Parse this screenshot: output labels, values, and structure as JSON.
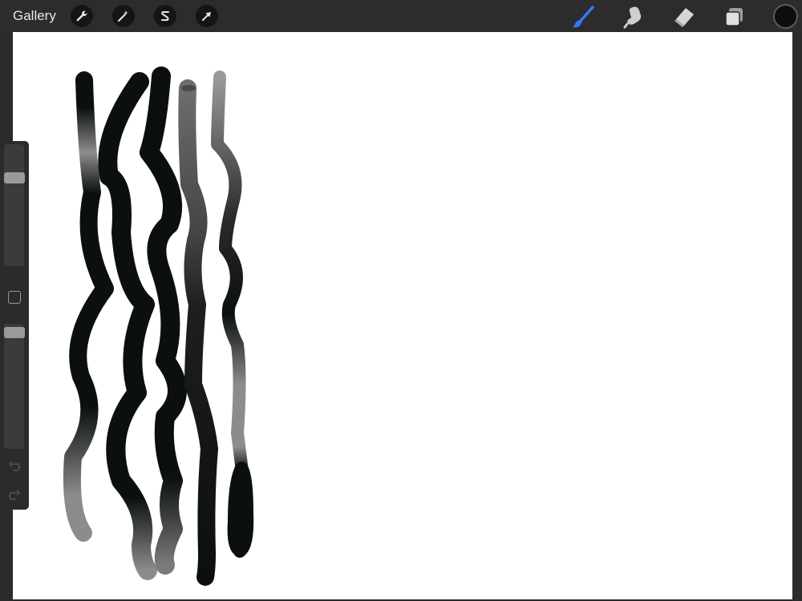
{
  "topbar": {
    "gallery_label": "Gallery",
    "left_tools": [
      {
        "name": "actions",
        "icon": "wrench-icon"
      },
      {
        "name": "adjustments",
        "icon": "magic-wand-icon"
      },
      {
        "name": "selection",
        "icon": "selection-s-icon"
      },
      {
        "name": "transform",
        "icon": "arrow-cursor-icon"
      }
    ],
    "right_tools": [
      {
        "name": "brush",
        "icon": "brush-icon",
        "active": true
      },
      {
        "name": "smudge",
        "icon": "smudge-finger-icon",
        "active": false
      },
      {
        "name": "eraser",
        "icon": "eraser-icon",
        "active": false
      },
      {
        "name": "layers",
        "icon": "layers-icon",
        "active": false
      }
    ],
    "current_color": "#0b0f0f"
  },
  "sidebar": {
    "brush_size_level": 0.75,
    "opacity_level": 0.97,
    "icons": [
      "undo-icon",
      "redo-icon"
    ]
  },
  "colors": {
    "accent_active": "#3478f6",
    "ink": "#0b0f0f"
  }
}
